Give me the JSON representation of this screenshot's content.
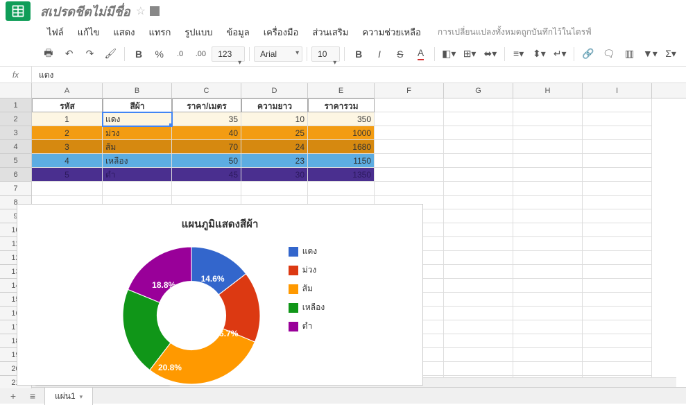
{
  "doc": {
    "title": "สเปรดชีตไม่มีชื่อ"
  },
  "menu": {
    "file": "ไฟล์",
    "edit": "แก้ไข",
    "view": "แสดง",
    "insert": "แทรก",
    "format": "รูปแบบ",
    "data": "ข้อมูล",
    "tools": "เครื่องมือ",
    "addons": "ส่วนเสริม",
    "help": "ความช่วยเหลือ",
    "status": "การเปลี่ยนแปลงทั้งหมดถูกบันทึกไว้ในไดรฟ์"
  },
  "toolbar": {
    "font": "Arial",
    "size": "10",
    "fmt123": "123",
    "pct": "%",
    "dec0": ".0",
    "dec00": ".00"
  },
  "formula": {
    "fx": "fx",
    "value": "แดง"
  },
  "cols": [
    "A",
    "B",
    "C",
    "D",
    "E",
    "F",
    "G",
    "H",
    "I"
  ],
  "rows": [
    "1",
    "2",
    "3",
    "4",
    "5",
    "6",
    "7",
    "8",
    "9",
    "10",
    "11",
    "12",
    "13",
    "14",
    "15",
    "16",
    "17",
    "18",
    "19",
    "20",
    "21"
  ],
  "headers": {
    "a": "รหัส",
    "b": "สีผ้า",
    "c": "ราคา/เมตร",
    "d": "ความยาว",
    "e": "ราคารวม"
  },
  "data_rows": [
    {
      "id": "1",
      "color": "แดง",
      "price": "35",
      "len": "10",
      "total": "350"
    },
    {
      "id": "2",
      "color": "ม่วง",
      "price": "40",
      "len": "25",
      "total": "1000"
    },
    {
      "id": "3",
      "color": "ส้ม",
      "price": "70",
      "len": "24",
      "total": "1680"
    },
    {
      "id": "4",
      "color": "เหลือง",
      "price": "50",
      "len": "23",
      "total": "1150"
    },
    {
      "id": "5",
      "color": "ดำ",
      "price": "45",
      "len": "30",
      "total": "1350"
    }
  ],
  "chart_data": {
    "type": "pie",
    "title": "แผนภูมิแสดงสีผ้า",
    "series": [
      {
        "name": "แดง",
        "value": 14.6,
        "color": "#3366cc"
      },
      {
        "name": "ม่วง",
        "value": 16.7,
        "color": "#dc3912"
      },
      {
        "name": "ส้ม",
        "value": 29.1,
        "color": "#ff9900"
      },
      {
        "name": "เหลือง",
        "value": 20.8,
        "color": "#109618"
      },
      {
        "name": "ดำ",
        "value": 18.8,
        "color": "#990099"
      }
    ],
    "labels_shown": {
      "red": "14.6%",
      "purple": "16.7%",
      "green": "20.8%",
      "violet": "18.8%"
    }
  },
  "tabs": {
    "sheet1": "แผ่น1"
  }
}
